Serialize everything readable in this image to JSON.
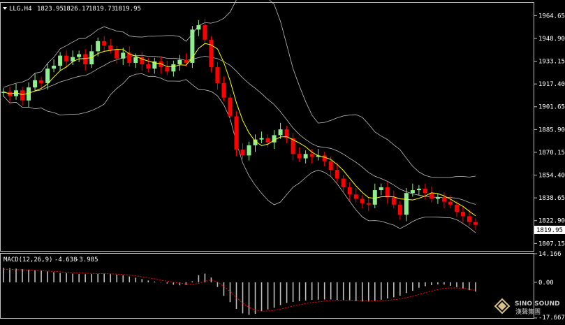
{
  "header": {
    "dropdown_arrow": "triangle-down-icon",
    "symbol": "LLG,H4",
    "ohlc": [
      "1823.95",
      "1826.17",
      "1819.73",
      "1819.95"
    ]
  },
  "price_axis": {
    "ticks": [
      "1964.65",
      "1948.90",
      "1933.15",
      "1917.40",
      "1901.65",
      "1885.90",
      "1870.15",
      "1854.40",
      "1838.65",
      "1822.90",
      "1807.15"
    ],
    "current_price_label": "1819.95"
  },
  "macd_header": {
    "name": "MACD(12,26,9)",
    "values": [
      "-4.638",
      "-3.985"
    ]
  },
  "macd_axis": {
    "ticks": [
      "14.166",
      "0.00",
      "-17.667"
    ]
  },
  "watermark": {
    "brand": "SINO SOUND",
    "sub": "漢聲集團",
    "icon": "diamond-logo-icon"
  },
  "colors": {
    "background": "#000000",
    "bull": "#90ee90",
    "bear": "#ff0000",
    "ma": "#ffff00",
    "bands": "#c0c0c0",
    "frame": "#c0c0c0",
    "macd_hist": "#c0c0c0",
    "macd_signal": "#ff0000",
    "text": "#ffffff"
  },
  "chart_data": [
    {
      "type": "candlestick",
      "symbol": "LLG",
      "timeframe": "H4",
      "ylim": [
        1802,
        1974
      ],
      "indicators": [
        "Bollinger Bands",
        "Moving Average"
      ],
      "grid": false,
      "close": [
        1912,
        1909,
        1913,
        1906,
        1915,
        1920,
        1918,
        1928,
        1930,
        1937,
        1933,
        1936,
        1938,
        1931,
        1940,
        1947,
        1944,
        1941,
        1935,
        1939,
        1932,
        1936,
        1931,
        1928,
        1933,
        1929,
        1926,
        1931,
        1934,
        1932,
        1955,
        1958,
        1948,
        1929,
        1918,
        1908,
        1895,
        1872,
        1868,
        1875,
        1879,
        1880,
        1877,
        1882,
        1886,
        1880,
        1869,
        1866,
        1869,
        1867,
        1868,
        1864,
        1858,
        1852,
        1846,
        1841,
        1838,
        1835,
        1834,
        1844,
        1846,
        1839,
        1834,
        1827,
        1842,
        1844,
        1845,
        1842,
        1838,
        1839,
        1836,
        1834,
        1829,
        1826,
        1822,
        1820
      ],
      "bull_bear": [
        "up",
        "down",
        "up",
        "down",
        "up",
        "up",
        "down",
        "up",
        "up",
        "up",
        "down",
        "up",
        "up",
        "down",
        "up",
        "up",
        "down",
        "down",
        "down",
        "up",
        "down",
        "up",
        "down",
        "down",
        "up",
        "down",
        "down",
        "up",
        "up",
        "down",
        "up",
        "up",
        "down",
        "down",
        "down",
        "down",
        "down",
        "down",
        "down",
        "up",
        "up",
        "up",
        "down",
        "up",
        "up",
        "down",
        "down",
        "down",
        "up",
        "down",
        "up",
        "down",
        "down",
        "down",
        "down",
        "down",
        "down",
        "down",
        "down",
        "up",
        "up",
        "down",
        "down",
        "down",
        "up",
        "up",
        "up",
        "down",
        "down",
        "up",
        "down",
        "down",
        "down",
        "down",
        "down",
        "down"
      ]
    },
    {
      "type": "bar",
      "name": "MACD(12,26,9)",
      "ylim": [
        -17.667,
        14.166
      ],
      "values": [
        7.2,
        7.0,
        6.8,
        6.5,
        6.3,
        6.1,
        5.8,
        5.4,
        5.0,
        4.6,
        4.5,
        4.3,
        4.1,
        4.0,
        4.1,
        4.2,
        4.4,
        4.1,
        3.8,
        3.5,
        2.9,
        2.3,
        1.6,
        0.9,
        0.4,
        -0.1,
        -0.6,
        -1.2,
        -1.5,
        -1.3,
        0.5,
        3.5,
        4.3,
        2.4,
        -2.3,
        -6.7,
        -9.8,
        -13.2,
        -15.4,
        -16.1,
        -15.6,
        -14.3,
        -13.4,
        -12.6,
        -11.3,
        -10.2,
        -9.7,
        -9.3,
        -9.0,
        -8.7,
        -8.6,
        -8.5,
        -8.5,
        -8.7,
        -8.9,
        -9.1,
        -9.3,
        -9.5,
        -9.5,
        -9.2,
        -8.6,
        -8.0,
        -7.4,
        -6.6,
        -5.3,
        -4.2,
        -2.7,
        -1.9,
        -1.4,
        -1.0,
        -1.1,
        -1.7,
        -2.4,
        -3.1,
        -3.9,
        -4.6
      ],
      "signal": [
        6.5,
        6.4,
        6.3,
        6.2,
        6.1,
        5.9,
        5.8,
        5.6,
        5.4,
        5.2,
        5.0,
        4.8,
        4.7,
        4.5,
        4.4,
        4.3,
        4.3,
        4.2,
        4.1,
        3.9,
        3.6,
        3.2,
        2.7,
        2.2,
        1.7,
        1.1,
        0.6,
        0.0,
        -0.4,
        -0.8,
        -1.0,
        -0.5,
        0.5,
        1.2,
        0.2,
        -2.0,
        -4.6,
        -7.6,
        -10.3,
        -12.4,
        -13.7,
        -14.3,
        -14.2,
        -13.9,
        -13.2,
        -12.5,
        -11.8,
        -11.1,
        -10.5,
        -10.0,
        -9.7,
        -9.3,
        -9.1,
        -8.9,
        -8.8,
        -8.8,
        -8.9,
        -9.0,
        -9.1,
        -9.2,
        -9.1,
        -8.9,
        -8.6,
        -8.2,
        -7.6,
        -6.9,
        -6.0,
        -5.1,
        -4.3,
        -3.6,
        -3.0,
        -2.8,
        -2.8,
        -3.0,
        -3.4,
        -3.985
      ]
    }
  ]
}
